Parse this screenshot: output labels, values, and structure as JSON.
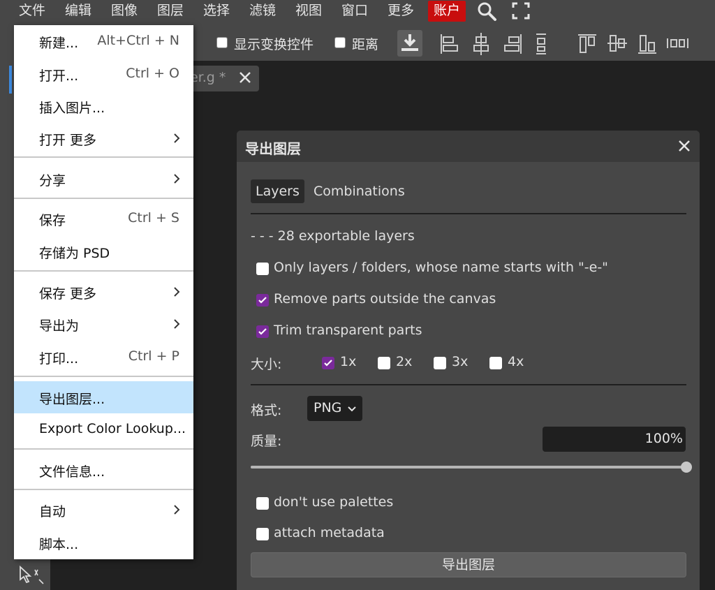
{
  "menubar": {
    "items": [
      "文件",
      "编辑",
      "图像",
      "图层",
      "选择",
      "滤镜",
      "视图",
      "窗口",
      "更多",
      "账户"
    ],
    "search_icon": "search-icon",
    "fullscreen_icon": "fullscreen-icon",
    "account_color": "#c80e0e"
  },
  "toolbar": {
    "show_transform_label": "显示变换控件",
    "distance_label": "距离",
    "icons": [
      "download-icon",
      "align-left-icon",
      "align-center-h-icon",
      "align-right-icon",
      "distribute-v-icon",
      "align-top-icon",
      "align-middle-v-icon",
      "align-bottom-icon",
      "distribute-h-icon"
    ]
  },
  "document_tab": {
    "label": "er.g *",
    "close_icon": "close-icon"
  },
  "file_menu": {
    "items": [
      {
        "label": "新建...",
        "shortcut": "Alt+Ctrl + N"
      },
      {
        "label": "打开...",
        "shortcut": "Ctrl + O"
      },
      {
        "label": "插入图片...",
        "shortcut": ""
      },
      {
        "label": "打开 更多",
        "shortcut": "",
        "submenu": true
      },
      {
        "label": "分享",
        "shortcut": "",
        "submenu": true
      },
      {
        "label": "保存",
        "shortcut": "Ctrl + S"
      },
      {
        "label": "存储为 PSD",
        "shortcut": ""
      },
      {
        "label": "保存 更多",
        "shortcut": "",
        "submenu": true
      },
      {
        "label": "导出为",
        "shortcut": "",
        "submenu": true
      },
      {
        "label": "打印...",
        "shortcut": "Ctrl + P"
      },
      {
        "label": "导出图层...",
        "shortcut": "",
        "highlighted": true
      },
      {
        "label": "Export Color Lookup...",
        "shortcut": ""
      },
      {
        "label": "文件信息...",
        "shortcut": ""
      },
      {
        "label": "自动",
        "shortcut": "",
        "submenu": true
      },
      {
        "label": "脚本...",
        "shortcut": ""
      }
    ],
    "highlight_color": "#c2e4fd"
  },
  "dialog": {
    "title": "导出图层",
    "tabs": [
      "Layers",
      "Combinations"
    ],
    "layer_count_text": "- - - 28 exportable layers",
    "options": [
      {
        "label": "Only layers / folders, whose name starts with \"-e-\"",
        "checked": false
      },
      {
        "label": "Remove parts outside the canvas",
        "checked": true
      },
      {
        "label": "Trim transparent parts",
        "checked": true
      }
    ],
    "size_label": "大小:",
    "sizes": [
      {
        "label": "1x",
        "checked": true
      },
      {
        "label": "2x",
        "checked": false
      },
      {
        "label": "3x",
        "checked": false
      },
      {
        "label": "4x",
        "checked": false
      }
    ],
    "format_label": "格式:",
    "format_value": "PNG",
    "quality_label": "质量:",
    "quality_value": "100%",
    "quality_level": 1.0,
    "extra_options": [
      {
        "label": "don't use palettes",
        "checked": false
      },
      {
        "label": "attach metadata",
        "checked": false
      }
    ],
    "export_button": "导出图层",
    "check_color": "#7a2a9b"
  }
}
